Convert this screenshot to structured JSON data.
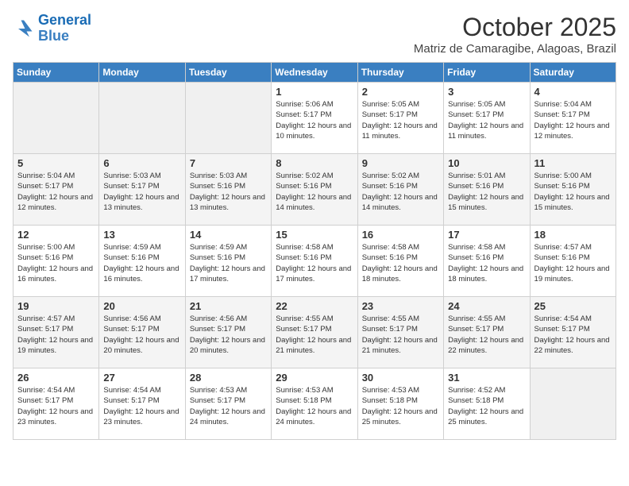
{
  "header": {
    "logo_line1": "General",
    "logo_line2": "Blue",
    "month": "October 2025",
    "location": "Matriz de Camaragibe, Alagoas, Brazil"
  },
  "days_of_week": [
    "Sunday",
    "Monday",
    "Tuesday",
    "Wednesday",
    "Thursday",
    "Friday",
    "Saturday"
  ],
  "weeks": [
    [
      {
        "day": "",
        "info": ""
      },
      {
        "day": "",
        "info": ""
      },
      {
        "day": "",
        "info": ""
      },
      {
        "day": "1",
        "info": "Sunrise: 5:06 AM\nSunset: 5:17 PM\nDaylight: 12 hours and 10 minutes."
      },
      {
        "day": "2",
        "info": "Sunrise: 5:05 AM\nSunset: 5:17 PM\nDaylight: 12 hours and 11 minutes."
      },
      {
        "day": "3",
        "info": "Sunrise: 5:05 AM\nSunset: 5:17 PM\nDaylight: 12 hours and 11 minutes."
      },
      {
        "day": "4",
        "info": "Sunrise: 5:04 AM\nSunset: 5:17 PM\nDaylight: 12 hours and 12 minutes."
      }
    ],
    [
      {
        "day": "5",
        "info": "Sunrise: 5:04 AM\nSunset: 5:17 PM\nDaylight: 12 hours and 12 minutes."
      },
      {
        "day": "6",
        "info": "Sunrise: 5:03 AM\nSunset: 5:17 PM\nDaylight: 12 hours and 13 minutes."
      },
      {
        "day": "7",
        "info": "Sunrise: 5:03 AM\nSunset: 5:16 PM\nDaylight: 12 hours and 13 minutes."
      },
      {
        "day": "8",
        "info": "Sunrise: 5:02 AM\nSunset: 5:16 PM\nDaylight: 12 hours and 14 minutes."
      },
      {
        "day": "9",
        "info": "Sunrise: 5:02 AM\nSunset: 5:16 PM\nDaylight: 12 hours and 14 minutes."
      },
      {
        "day": "10",
        "info": "Sunrise: 5:01 AM\nSunset: 5:16 PM\nDaylight: 12 hours and 15 minutes."
      },
      {
        "day": "11",
        "info": "Sunrise: 5:00 AM\nSunset: 5:16 PM\nDaylight: 12 hours and 15 minutes."
      }
    ],
    [
      {
        "day": "12",
        "info": "Sunrise: 5:00 AM\nSunset: 5:16 PM\nDaylight: 12 hours and 16 minutes."
      },
      {
        "day": "13",
        "info": "Sunrise: 4:59 AM\nSunset: 5:16 PM\nDaylight: 12 hours and 16 minutes."
      },
      {
        "day": "14",
        "info": "Sunrise: 4:59 AM\nSunset: 5:16 PM\nDaylight: 12 hours and 17 minutes."
      },
      {
        "day": "15",
        "info": "Sunrise: 4:58 AM\nSunset: 5:16 PM\nDaylight: 12 hours and 17 minutes."
      },
      {
        "day": "16",
        "info": "Sunrise: 4:58 AM\nSunset: 5:16 PM\nDaylight: 12 hours and 18 minutes."
      },
      {
        "day": "17",
        "info": "Sunrise: 4:58 AM\nSunset: 5:16 PM\nDaylight: 12 hours and 18 minutes."
      },
      {
        "day": "18",
        "info": "Sunrise: 4:57 AM\nSunset: 5:16 PM\nDaylight: 12 hours and 19 minutes."
      }
    ],
    [
      {
        "day": "19",
        "info": "Sunrise: 4:57 AM\nSunset: 5:17 PM\nDaylight: 12 hours and 19 minutes."
      },
      {
        "day": "20",
        "info": "Sunrise: 4:56 AM\nSunset: 5:17 PM\nDaylight: 12 hours and 20 minutes."
      },
      {
        "day": "21",
        "info": "Sunrise: 4:56 AM\nSunset: 5:17 PM\nDaylight: 12 hours and 20 minutes."
      },
      {
        "day": "22",
        "info": "Sunrise: 4:55 AM\nSunset: 5:17 PM\nDaylight: 12 hours and 21 minutes."
      },
      {
        "day": "23",
        "info": "Sunrise: 4:55 AM\nSunset: 5:17 PM\nDaylight: 12 hours and 21 minutes."
      },
      {
        "day": "24",
        "info": "Sunrise: 4:55 AM\nSunset: 5:17 PM\nDaylight: 12 hours and 22 minutes."
      },
      {
        "day": "25",
        "info": "Sunrise: 4:54 AM\nSunset: 5:17 PM\nDaylight: 12 hours and 22 minutes."
      }
    ],
    [
      {
        "day": "26",
        "info": "Sunrise: 4:54 AM\nSunset: 5:17 PM\nDaylight: 12 hours and 23 minutes."
      },
      {
        "day": "27",
        "info": "Sunrise: 4:54 AM\nSunset: 5:17 PM\nDaylight: 12 hours and 23 minutes."
      },
      {
        "day": "28",
        "info": "Sunrise: 4:53 AM\nSunset: 5:17 PM\nDaylight: 12 hours and 24 minutes."
      },
      {
        "day": "29",
        "info": "Sunrise: 4:53 AM\nSunset: 5:18 PM\nDaylight: 12 hours and 24 minutes."
      },
      {
        "day": "30",
        "info": "Sunrise: 4:53 AM\nSunset: 5:18 PM\nDaylight: 12 hours and 25 minutes."
      },
      {
        "day": "31",
        "info": "Sunrise: 4:52 AM\nSunset: 5:18 PM\nDaylight: 12 hours and 25 minutes."
      },
      {
        "day": "",
        "info": ""
      }
    ]
  ]
}
